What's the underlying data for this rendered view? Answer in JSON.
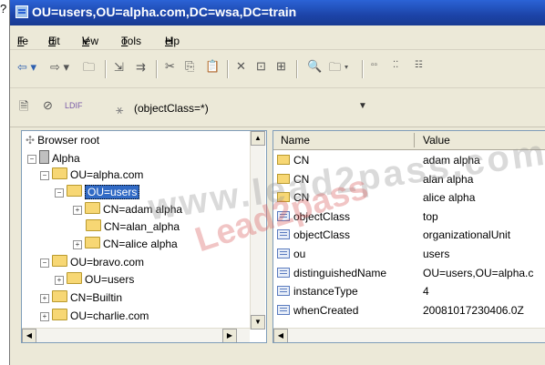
{
  "page": {
    "marker": "?"
  },
  "window": {
    "title": "OU=users,OU=alpha.com,DC=wsa,DC=train"
  },
  "menu": [
    {
      "label": "File",
      "key": "F",
      "rest": "ile"
    },
    {
      "label": "Edit",
      "key": "E",
      "rest": "dit"
    },
    {
      "label": "View",
      "key": "V",
      "rest": "iew"
    },
    {
      "label": "Tools",
      "key": "T",
      "rest": "ools"
    },
    {
      "label": "Help",
      "key": "H",
      "rest": "elp"
    }
  ],
  "toolbar": {
    "ldif_label": "LDIF"
  },
  "filter": {
    "text": "(objectClass=*)"
  },
  "tree": {
    "root": "Browser root",
    "server": "Alpha",
    "items": [
      "OU=alpha.com",
      "OU=users",
      "CN=adam alpha",
      "CN=alan_alpha",
      "CN=alice alpha",
      "OU=bravo.com",
      "OU=users",
      "CN=Builtin",
      "OU=charlie.com"
    ]
  },
  "properties": {
    "columns": {
      "name": "Name",
      "value": "Value"
    },
    "rows": [
      {
        "icon": "folder",
        "name": "CN",
        "value": "adam alpha"
      },
      {
        "icon": "folder",
        "name": "CN",
        "value": "alan alpha"
      },
      {
        "icon": "folder",
        "name": "CN",
        "value": "alice alpha"
      },
      {
        "icon": "attribute",
        "name": "objectClass",
        "value": "top"
      },
      {
        "icon": "attribute",
        "name": "objectClass",
        "value": "organizationalUnit"
      },
      {
        "icon": "attribute",
        "name": "ou",
        "value": "users"
      },
      {
        "icon": "attribute",
        "name": "distinguishedName",
        "value": "OU=users,OU=alpha.c"
      },
      {
        "icon": "attribute",
        "name": "instanceType",
        "value": "4"
      },
      {
        "icon": "attribute",
        "name": "whenCreated",
        "value": "20081017230406.0Z"
      }
    ]
  },
  "watermark": {
    "line1": "www.lead2pass.com",
    "line2": "Lead2pass"
  },
  "colors": {
    "title_bar": "#1c44a8",
    "selection": "#316ac5",
    "folder": "#f7d774"
  }
}
